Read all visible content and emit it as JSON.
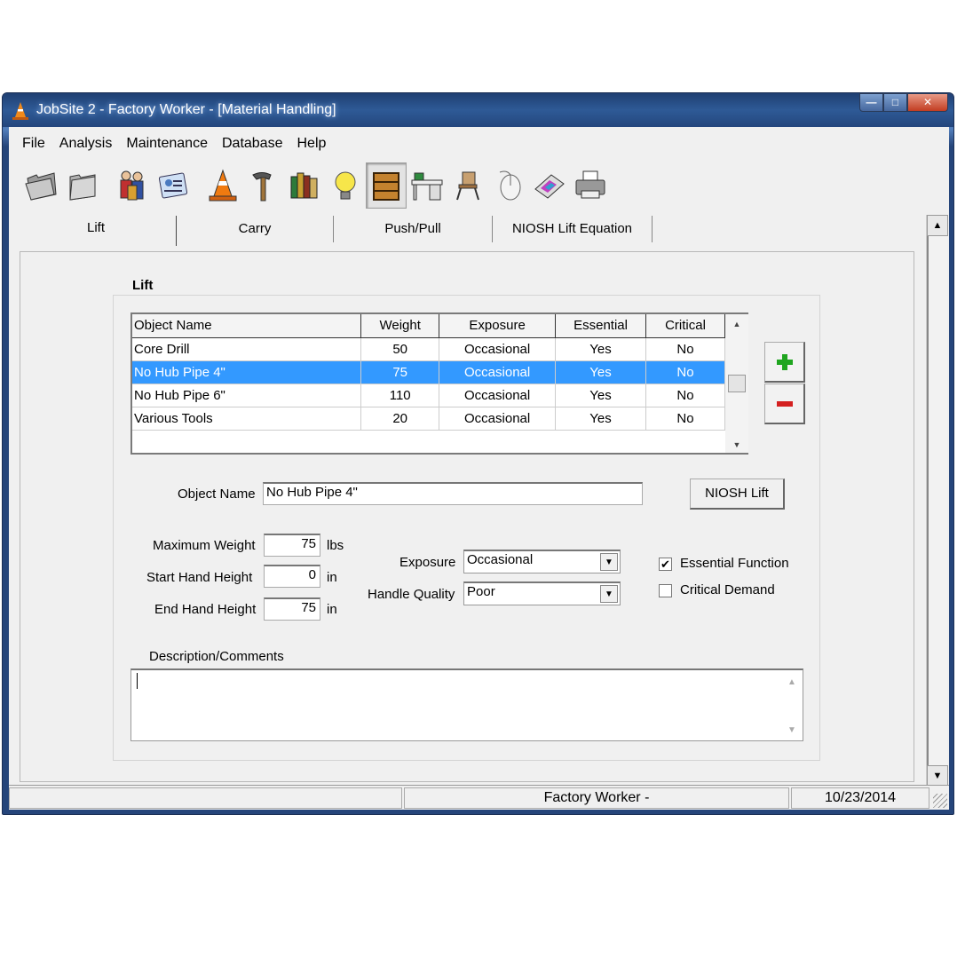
{
  "window": {
    "title": "JobSite 2 - Factory Worker - [Material Handling]"
  },
  "menu": [
    "File",
    "Analysis",
    "Maintenance",
    "Database",
    "Help"
  ],
  "toolbar": {
    "icons": [
      "open-folder-icon",
      "folder-icon",
      "workers-icon",
      "id-card-icon",
      "traffic-cone-icon",
      "hammer-icon",
      "books-icon",
      "lightbulb-icon",
      "crate-icon",
      "desk-icon",
      "chair-icon",
      "mouse-icon",
      "keyboard-icon",
      "printer-icon"
    ],
    "pressed": "crate-icon"
  },
  "tabs": [
    "Lift",
    "Carry",
    "Push/Pull",
    "NIOSH Lift Equation"
  ],
  "active_tab": "Lift",
  "group_title": "Lift",
  "table": {
    "columns": [
      "Object Name",
      "Weight",
      "Exposure",
      "Essential",
      "Critical"
    ],
    "rows": [
      [
        "Core Drill",
        "50",
        "Occasional",
        "Yes",
        "No"
      ],
      [
        "No Hub Pipe 4\"",
        "75",
        "Occasional",
        "Yes",
        "No"
      ],
      [
        "No Hub Pipe 6\"",
        "110",
        "Occasional",
        "Yes",
        "No"
      ],
      [
        "Various Tools",
        "20",
        "Occasional",
        "Yes",
        "No"
      ]
    ],
    "selected_row": 1
  },
  "form": {
    "object_name_label": "Object Name",
    "object_name_value": "No Hub Pipe 4\"",
    "niosh_button": "NIOSH Lift",
    "max_weight_label": "Maximum Weight",
    "max_weight_value": "75",
    "max_weight_unit": "lbs",
    "start_height_label": "Start Hand Height",
    "start_height_value": "0",
    "start_height_unit": "in",
    "end_height_label": "End Hand Height",
    "end_height_value": "75",
    "end_height_unit": "in",
    "exposure_label": "Exposure",
    "exposure_value": "Occasional",
    "handle_label": "Handle Quality",
    "handle_value": "Poor",
    "essential_label": "Essential Function",
    "essential_checked": true,
    "critical_label": "Critical Demand",
    "critical_checked": false,
    "description_label": "Description/Comments",
    "description_value": ""
  },
  "status": {
    "center": "Factory Worker -",
    "date": "10/23/2014"
  },
  "colors": {
    "selection": "#3399ff",
    "add": "#1fa51f",
    "remove": "#d42020"
  }
}
